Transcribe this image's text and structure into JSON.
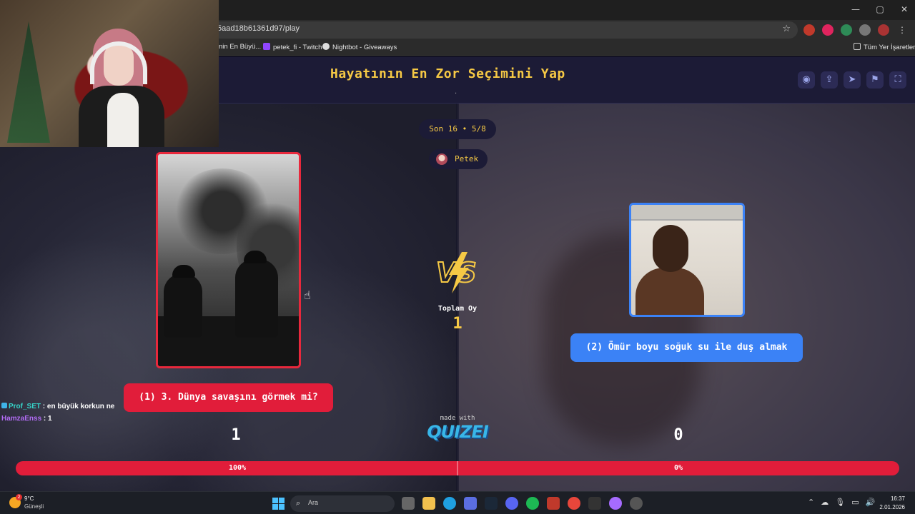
{
  "browser": {
    "url": "5aad18b61361d97/play",
    "bookmarks": [
      {
        "label": "nin En Büyü...",
        "color": ""
      },
      {
        "label": "petek_fi - Twitch",
        "color": "#9146ff"
      },
      {
        "label": "Nightbot - Giveaways",
        "color": "#dddddd"
      }
    ],
    "all_bookmarks_label": "Tüm Yer İşaretleri",
    "window_controls": [
      "—",
      "▢",
      "✕"
    ]
  },
  "game": {
    "title": "Hayatının En Zor Seçimini Yap",
    "title_subtitle": ".",
    "header_icons": [
      "eye-icon",
      "share-icon",
      "send-icon",
      "flag-icon",
      "fullscreen-icon"
    ],
    "round": "Son 16 • 5/8",
    "player": "Petek",
    "left_option": {
      "label": "(1) 3. Dünya savaşını görmek mi?",
      "votes": "1",
      "percent": "100%"
    },
    "right_option": {
      "label": "(2) Ömür boyu soğuk su ile duş almak",
      "votes": "0",
      "percent": "0%"
    },
    "vs_text": "VS",
    "total_label": "Toplam Oy",
    "total_value": "1",
    "made_with": "made with",
    "brand": "QUIZEI",
    "colors": {
      "accent_yellow": "#f6c945",
      "left_red": "#e11d3a",
      "right_blue": "#3b82f6",
      "header_bg": "#1c1b36"
    }
  },
  "chat": [
    {
      "user": "Prof_SET",
      "message": " : en büyük korkun ne"
    },
    {
      "user": "HamzaEnss",
      "message": " : 1"
    }
  ],
  "taskbar": {
    "weather_temp": "9°C",
    "weather_desc": "Güneşli",
    "weather_badge": "2",
    "search_placeholder": "Ara",
    "time": "16:37",
    "date": "2.01.2026"
  }
}
